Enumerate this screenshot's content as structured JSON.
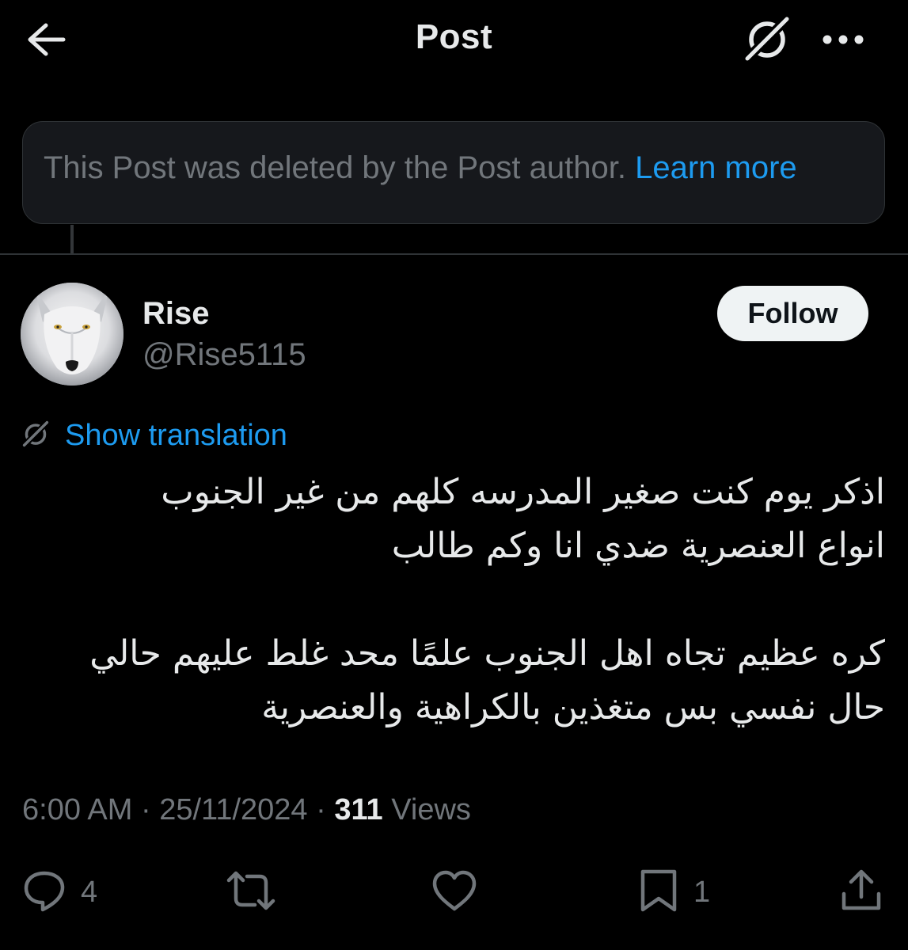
{
  "header": {
    "title": "Post"
  },
  "deleted_notice": {
    "text": "This Post was deleted by the Post author.",
    "link": "Learn more"
  },
  "author": {
    "name": "Rise",
    "handle": "@Rise5115",
    "follow_label": "Follow"
  },
  "translation": {
    "label": "Show translation"
  },
  "post": {
    "lines": [
      "اذكر يوم كنت صغير المدرسه كلهم من غير الجنوب",
      "انواع العنصرية ضدي انا وكم طالب",
      "كره عظيم تجاه اهل الجنوب علمًا محد غلط عليهم حالي",
      "حال نفسي بس متغذين بالكراهية والعنصرية"
    ]
  },
  "meta": {
    "time": "6:00 AM",
    "date": "25/11/2024",
    "views_count": "311",
    "views_label": "Views"
  },
  "actions": {
    "reply_count": "4",
    "bookmark_count": "1"
  },
  "colors": {
    "background": "#000000",
    "text": "#e7e9ea",
    "secondary": "#71767b",
    "accent": "#1d9bf0",
    "border": "#2f3336"
  }
}
